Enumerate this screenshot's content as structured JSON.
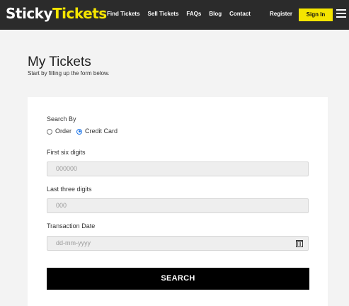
{
  "header": {
    "logo_part1": "Sticky",
    "logo_part2": "Tickets",
    "nav": [
      "Find Tickets",
      "Sell Tickets",
      "FAQs",
      "Blog",
      "Contact"
    ],
    "register_label": "Register",
    "signin_label": "Sign In",
    "menu_icon": "hamburger-menu-icon"
  },
  "page": {
    "title": "My Tickets",
    "subtitle": "Start by filling up the form below."
  },
  "form": {
    "search_by_label": "Search By",
    "options": [
      "Order",
      "Credit Card"
    ],
    "selected_option": "Credit Card",
    "first_six_label": "First six digits",
    "first_six_placeholder": "000000",
    "last_three_label": "Last three digits",
    "last_three_placeholder": "000",
    "date_label": "Transaction Date",
    "date_placeholder": "dd-mm-yyyy",
    "date_icon": "calendar-icon",
    "search_button": "SEARCH"
  },
  "colors": {
    "nav_bg": "#2b2b2b",
    "accent": "#f5e500",
    "button_bg": "#000000"
  }
}
